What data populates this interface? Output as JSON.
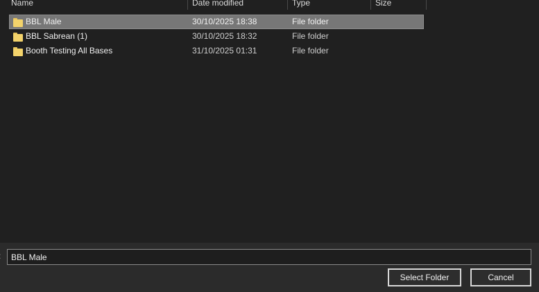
{
  "columns": [
    {
      "label": "Name"
    },
    {
      "label": "Date modified"
    },
    {
      "label": "Type"
    },
    {
      "label": "Size"
    }
  ],
  "rows": [
    {
      "name": "BBL Male",
      "date": "30/10/2025 18:38",
      "type": "File folder",
      "selected": true,
      "icon": "folder-icon"
    },
    {
      "name": "BBL Sabrean (1)",
      "date": "30/10/2025 18:32",
      "type": "File folder",
      "selected": false,
      "icon": "folder-icon"
    },
    {
      "name": "Booth Testing All Bases",
      "date": "31/10/2025 01:31",
      "type": "File folder",
      "selected": false,
      "icon": "folder-icon"
    }
  ],
  "folder_field": {
    "label_fragment": ":",
    "value": "BBL Male"
  },
  "buttons": {
    "select_label": "Select Folder",
    "cancel_label": "Cancel"
  },
  "colors": {
    "background": "#202020",
    "selection": "#777777",
    "folder": "#f3d36b"
  }
}
